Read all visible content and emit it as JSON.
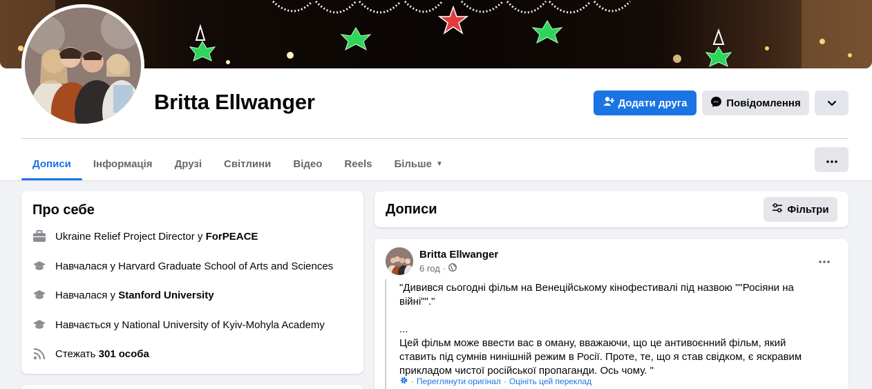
{
  "profile": {
    "name": "Britta Ellwanger"
  },
  "actions": {
    "add_friend": "Додати друга",
    "message": "Повідомлення"
  },
  "tabs": [
    {
      "label": "Дописи"
    },
    {
      "label": "Інформація"
    },
    {
      "label": "Друзі"
    },
    {
      "label": "Світлини"
    },
    {
      "label": "Відео"
    },
    {
      "label": "Reels"
    },
    {
      "label": "Більше"
    }
  ],
  "about": {
    "title": "Про себе",
    "rows": [
      {
        "icon": "briefcase-icon",
        "prefix": "Ukraine Relief Project Director у ",
        "bold": "ForPEACE",
        "suffix": ""
      },
      {
        "icon": "graduation-cap-icon",
        "prefix": "Навчалася у Harvard Graduate School of Arts and Sciences",
        "bold": "",
        "suffix": ""
      },
      {
        "icon": "graduation-cap-icon",
        "prefix": "Навчалася у ",
        "bold": "Stanford University",
        "suffix": ""
      },
      {
        "icon": "graduation-cap-icon",
        "prefix": "Навчається у National University of Kyiv-Mohyla Academy",
        "bold": "",
        "suffix": ""
      },
      {
        "icon": "rss-icon",
        "prefix": "Стежать ",
        "bold": "301 особа",
        "suffix": ""
      }
    ]
  },
  "posts": {
    "title": "Дописи",
    "filter_label": "Фільтри",
    "post": {
      "author": "Britta Ellwanger",
      "time": "6 год",
      "separator": "·",
      "text": "\"Дивився сьогодні фільм на Венеційському кінофестивалі під назвою \"\"Росіяни на війні\"\".\"\n\n...\nЦей фільм може ввести вас в оману, вважаючи, що це антивоєнний фільм, який ставить під сумнів нинішній режим в Росії. Проте, те, що я став свідком, є яскравим прикладом чистої російської пропаганди. Ось чому. \"",
      "translate_sep": "·",
      "see_original": "Переглянути оригінал",
      "rate_translation": "Оцініть цей переклад"
    }
  },
  "colors": {
    "accent": "#1b74e4",
    "secondary_btn": "#e4e6eb",
    "muted_text": "#65676b",
    "page_bg": "#f0f2f5"
  }
}
